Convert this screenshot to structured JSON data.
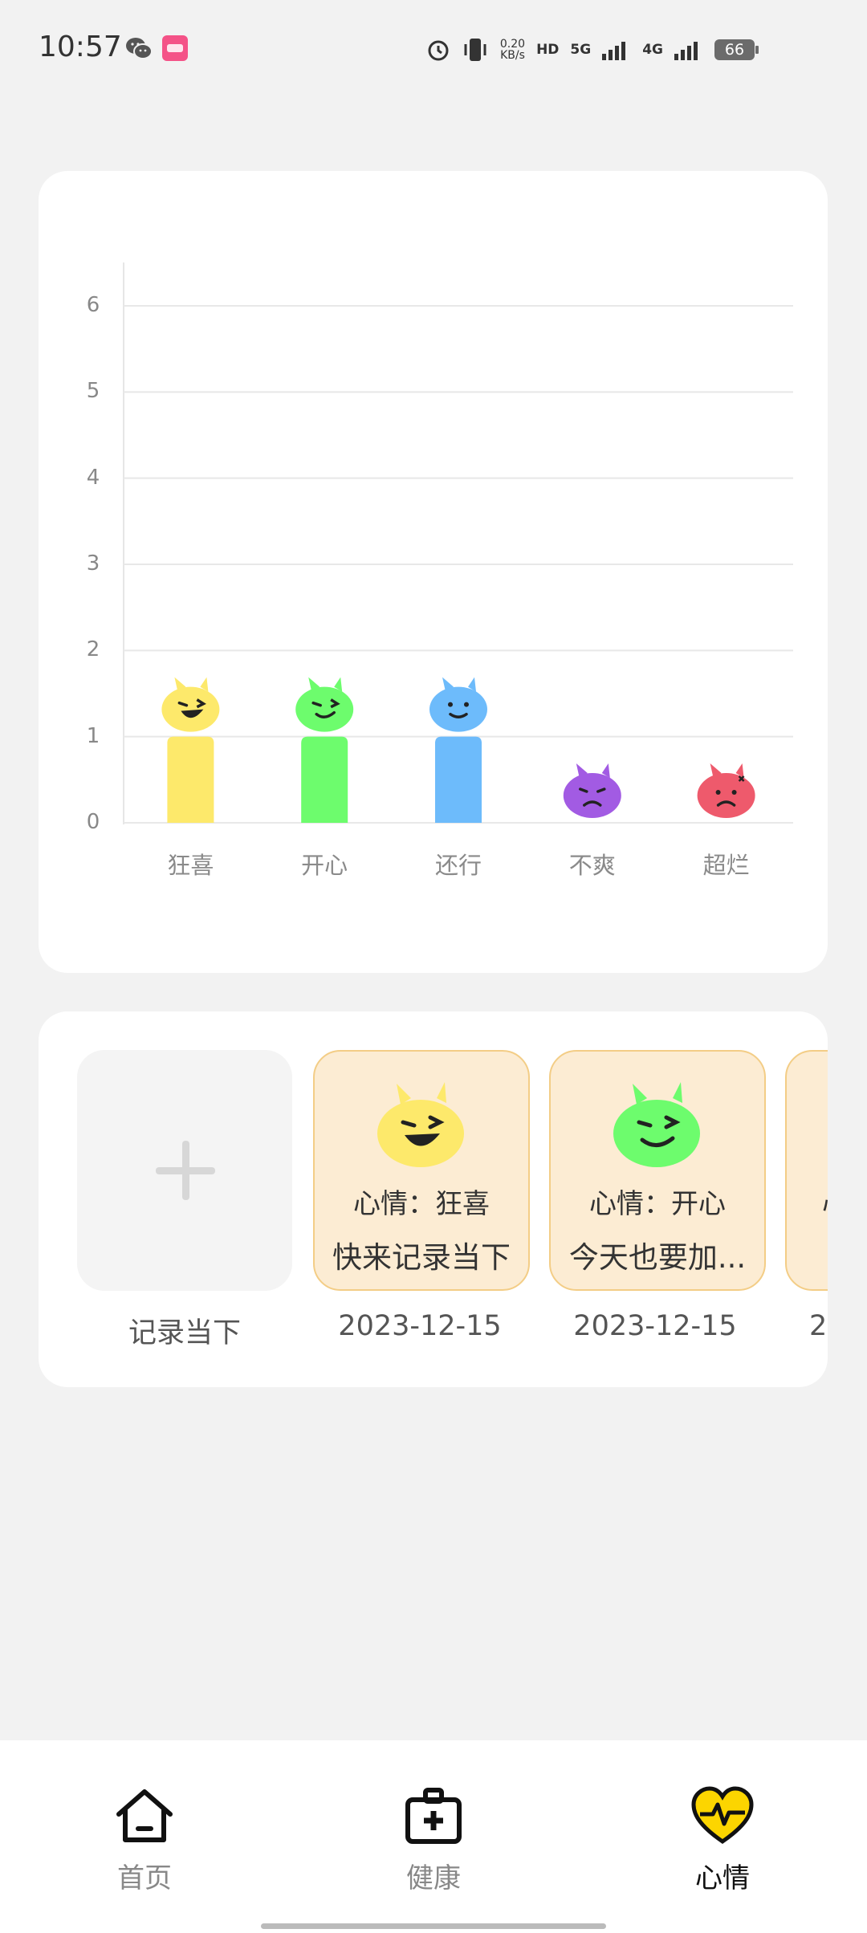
{
  "status_bar": {
    "time": "10:57",
    "net_speed_value": "0.20",
    "net_speed_unit": "KB/s",
    "hd_label": "HD",
    "net1": "5G",
    "net2": "4G",
    "battery": "66",
    "icons": [
      "wechat-icon",
      "app-notification-icon",
      "alarm-icon",
      "vibrate-icon",
      "signal-icon",
      "battery-icon"
    ]
  },
  "chart_data": {
    "type": "bar",
    "categories": [
      "狂喜",
      "开心",
      "还行",
      "不爽",
      "超烂"
    ],
    "values": [
      1,
      1,
      1,
      0,
      0
    ],
    "ylim": [
      0,
      6
    ],
    "yticks": [
      "0",
      "1",
      "2",
      "3",
      "4",
      "5",
      "6"
    ],
    "grid": true,
    "colors": [
      "#fde96b",
      "#6dfc6d",
      "#6dbbfb",
      "#a25be3",
      "#ee5a6c"
    ]
  },
  "records": {
    "add_label": "记录当下",
    "items": [
      {
        "mood": "心情：狂喜",
        "text": "快来记录当下",
        "date": "2023-12-15",
        "color": "#fde96b"
      },
      {
        "mood": "心情：开心",
        "text": "今天也要加...",
        "date": "2023-12-15",
        "color": "#6dfc6d"
      },
      {
        "mood": "心",
        "text": "",
        "date": "2",
        "color": "#fde96b"
      }
    ]
  },
  "nav": {
    "items": [
      {
        "label": "首页",
        "icon": "home-icon"
      },
      {
        "label": "健康",
        "icon": "medical-kit-icon"
      },
      {
        "label": "心情",
        "icon": "heart-pulse-icon"
      }
    ],
    "active_index": 2,
    "active_color": "#fcd500"
  }
}
